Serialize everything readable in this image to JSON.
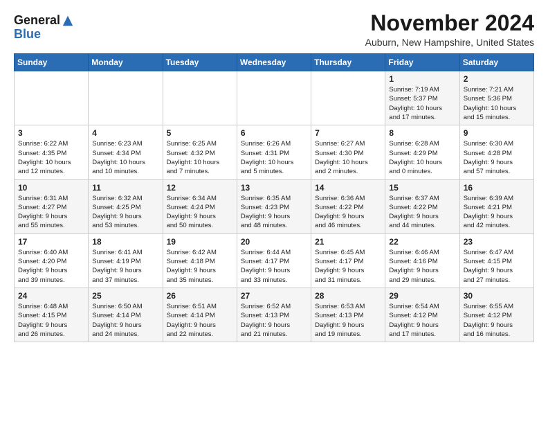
{
  "logo": {
    "line1": "General",
    "line2": "Blue"
  },
  "title": "November 2024",
  "location": "Auburn, New Hampshire, United States",
  "days_of_week": [
    "Sunday",
    "Monday",
    "Tuesday",
    "Wednesday",
    "Thursday",
    "Friday",
    "Saturday"
  ],
  "weeks": [
    [
      {
        "day": "",
        "info": ""
      },
      {
        "day": "",
        "info": ""
      },
      {
        "day": "",
        "info": ""
      },
      {
        "day": "",
        "info": ""
      },
      {
        "day": "",
        "info": ""
      },
      {
        "day": "1",
        "info": "Sunrise: 7:19 AM\nSunset: 5:37 PM\nDaylight: 10 hours\nand 17 minutes."
      },
      {
        "day": "2",
        "info": "Sunrise: 7:21 AM\nSunset: 5:36 PM\nDaylight: 10 hours\nand 15 minutes."
      }
    ],
    [
      {
        "day": "3",
        "info": "Sunrise: 6:22 AM\nSunset: 4:35 PM\nDaylight: 10 hours\nand 12 minutes."
      },
      {
        "day": "4",
        "info": "Sunrise: 6:23 AM\nSunset: 4:34 PM\nDaylight: 10 hours\nand 10 minutes."
      },
      {
        "day": "5",
        "info": "Sunrise: 6:25 AM\nSunset: 4:32 PM\nDaylight: 10 hours\nand 7 minutes."
      },
      {
        "day": "6",
        "info": "Sunrise: 6:26 AM\nSunset: 4:31 PM\nDaylight: 10 hours\nand 5 minutes."
      },
      {
        "day": "7",
        "info": "Sunrise: 6:27 AM\nSunset: 4:30 PM\nDaylight: 10 hours\nand 2 minutes."
      },
      {
        "day": "8",
        "info": "Sunrise: 6:28 AM\nSunset: 4:29 PM\nDaylight: 10 hours\nand 0 minutes."
      },
      {
        "day": "9",
        "info": "Sunrise: 6:30 AM\nSunset: 4:28 PM\nDaylight: 9 hours\nand 57 minutes."
      }
    ],
    [
      {
        "day": "10",
        "info": "Sunrise: 6:31 AM\nSunset: 4:27 PM\nDaylight: 9 hours\nand 55 minutes."
      },
      {
        "day": "11",
        "info": "Sunrise: 6:32 AM\nSunset: 4:25 PM\nDaylight: 9 hours\nand 53 minutes."
      },
      {
        "day": "12",
        "info": "Sunrise: 6:34 AM\nSunset: 4:24 PM\nDaylight: 9 hours\nand 50 minutes."
      },
      {
        "day": "13",
        "info": "Sunrise: 6:35 AM\nSunset: 4:23 PM\nDaylight: 9 hours\nand 48 minutes."
      },
      {
        "day": "14",
        "info": "Sunrise: 6:36 AM\nSunset: 4:22 PM\nDaylight: 9 hours\nand 46 minutes."
      },
      {
        "day": "15",
        "info": "Sunrise: 6:37 AM\nSunset: 4:22 PM\nDaylight: 9 hours\nand 44 minutes."
      },
      {
        "day": "16",
        "info": "Sunrise: 6:39 AM\nSunset: 4:21 PM\nDaylight: 9 hours\nand 42 minutes."
      }
    ],
    [
      {
        "day": "17",
        "info": "Sunrise: 6:40 AM\nSunset: 4:20 PM\nDaylight: 9 hours\nand 39 minutes."
      },
      {
        "day": "18",
        "info": "Sunrise: 6:41 AM\nSunset: 4:19 PM\nDaylight: 9 hours\nand 37 minutes."
      },
      {
        "day": "19",
        "info": "Sunrise: 6:42 AM\nSunset: 4:18 PM\nDaylight: 9 hours\nand 35 minutes."
      },
      {
        "day": "20",
        "info": "Sunrise: 6:44 AM\nSunset: 4:17 PM\nDaylight: 9 hours\nand 33 minutes."
      },
      {
        "day": "21",
        "info": "Sunrise: 6:45 AM\nSunset: 4:17 PM\nDaylight: 9 hours\nand 31 minutes."
      },
      {
        "day": "22",
        "info": "Sunrise: 6:46 AM\nSunset: 4:16 PM\nDaylight: 9 hours\nand 29 minutes."
      },
      {
        "day": "23",
        "info": "Sunrise: 6:47 AM\nSunset: 4:15 PM\nDaylight: 9 hours\nand 27 minutes."
      }
    ],
    [
      {
        "day": "24",
        "info": "Sunrise: 6:48 AM\nSunset: 4:15 PM\nDaylight: 9 hours\nand 26 minutes."
      },
      {
        "day": "25",
        "info": "Sunrise: 6:50 AM\nSunset: 4:14 PM\nDaylight: 9 hours\nand 24 minutes."
      },
      {
        "day": "26",
        "info": "Sunrise: 6:51 AM\nSunset: 4:14 PM\nDaylight: 9 hours\nand 22 minutes."
      },
      {
        "day": "27",
        "info": "Sunrise: 6:52 AM\nSunset: 4:13 PM\nDaylight: 9 hours\nand 21 minutes."
      },
      {
        "day": "28",
        "info": "Sunrise: 6:53 AM\nSunset: 4:13 PM\nDaylight: 9 hours\nand 19 minutes."
      },
      {
        "day": "29",
        "info": "Sunrise: 6:54 AM\nSunset: 4:12 PM\nDaylight: 9 hours\nand 17 minutes."
      },
      {
        "day": "30",
        "info": "Sunrise: 6:55 AM\nSunset: 4:12 PM\nDaylight: 9 hours\nand 16 minutes."
      }
    ]
  ],
  "accent_color": "#2a6db5"
}
